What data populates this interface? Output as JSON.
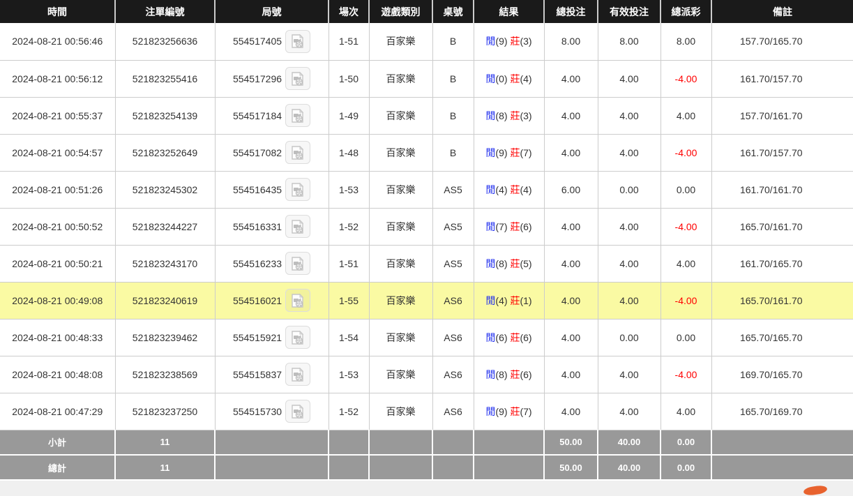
{
  "colors": {
    "header_bg": "#1a1a1a",
    "highlight_row": "#fafaa3",
    "player_blue": "#1f2dee",
    "banker_red": "#ff0000",
    "bet_amount_blue": "#2f6be4",
    "negative_red": "#ff0000",
    "summary_bg": "#999999"
  },
  "table": {
    "headers": [
      "時間",
      "注單編號",
      "局號",
      "場次",
      "遊戲類別",
      "桌號",
      "結果",
      "總投注",
      "有效投注",
      "總派彩",
      "備註"
    ],
    "rows": [
      {
        "time": "2024-08-21 00:56:46",
        "bet_id": "521823256636",
        "round": "554517405",
        "session": "1-51",
        "game": "百家樂",
        "table_no": "B",
        "result": {
          "player_label": "閒",
          "player_score": "(9)",
          "banker_label": "莊",
          "banker_score": "(3)"
        },
        "total_bet": "8.00",
        "valid_bet": "8.00",
        "payout": "8.00",
        "remark": "157.70/165.70",
        "highlight": false
      },
      {
        "time": "2024-08-21 00:56:12",
        "bet_id": "521823255416",
        "round": "554517296",
        "session": "1-50",
        "game": "百家樂",
        "table_no": "B",
        "result": {
          "player_label": "閒",
          "player_score": "(0)",
          "banker_label": "莊",
          "banker_score": "(4)"
        },
        "total_bet": "4.00",
        "valid_bet": "4.00",
        "payout": "-4.00",
        "remark": "161.70/157.70",
        "highlight": false
      },
      {
        "time": "2024-08-21 00:55:37",
        "bet_id": "521823254139",
        "round": "554517184",
        "session": "1-49",
        "game": "百家樂",
        "table_no": "B",
        "result": {
          "player_label": "閒",
          "player_score": "(8)",
          "banker_label": "莊",
          "banker_score": "(3)"
        },
        "total_bet": "4.00",
        "valid_bet": "4.00",
        "payout": "4.00",
        "remark": "157.70/161.70",
        "highlight": false
      },
      {
        "time": "2024-08-21 00:54:57",
        "bet_id": "521823252649",
        "round": "554517082",
        "session": "1-48",
        "game": "百家樂",
        "table_no": "B",
        "result": {
          "player_label": "閒",
          "player_score": "(9)",
          "banker_label": "莊",
          "banker_score": "(7)"
        },
        "total_bet": "4.00",
        "valid_bet": "4.00",
        "payout": "-4.00",
        "remark": "161.70/157.70",
        "highlight": false
      },
      {
        "time": "2024-08-21 00:51:26",
        "bet_id": "521823245302",
        "round": "554516435",
        "session": "1-53",
        "game": "百家樂",
        "table_no": "AS5",
        "result": {
          "player_label": "閒",
          "player_score": "(4)",
          "banker_label": "莊",
          "banker_score": "(4)"
        },
        "total_bet": "6.00",
        "valid_bet": "0.00",
        "payout": "0.00",
        "remark": "161.70/161.70",
        "highlight": false
      },
      {
        "time": "2024-08-21 00:50:52",
        "bet_id": "521823244227",
        "round": "554516331",
        "session": "1-52",
        "game": "百家樂",
        "table_no": "AS5",
        "result": {
          "player_label": "閒",
          "player_score": "(7)",
          "banker_label": "莊",
          "banker_score": "(6)"
        },
        "total_bet": "4.00",
        "valid_bet": "4.00",
        "payout": "-4.00",
        "remark": "165.70/161.70",
        "highlight": false
      },
      {
        "time": "2024-08-21 00:50:21",
        "bet_id": "521823243170",
        "round": "554516233",
        "session": "1-51",
        "game": "百家樂",
        "table_no": "AS5",
        "result": {
          "player_label": "閒",
          "player_score": "(8)",
          "banker_label": "莊",
          "banker_score": "(5)"
        },
        "total_bet": "4.00",
        "valid_bet": "4.00",
        "payout": "4.00",
        "remark": "161.70/165.70",
        "highlight": false
      },
      {
        "time": "2024-08-21 00:49:08",
        "bet_id": "521823240619",
        "round": "554516021",
        "session": "1-55",
        "game": "百家樂",
        "table_no": "AS6",
        "result": {
          "player_label": "閒",
          "player_score": "(4)",
          "banker_label": "莊",
          "banker_score": "(1)"
        },
        "total_bet": "4.00",
        "valid_bet": "4.00",
        "payout": "-4.00",
        "remark": "165.70/161.70",
        "highlight": true
      },
      {
        "time": "2024-08-21 00:48:33",
        "bet_id": "521823239462",
        "round": "554515921",
        "session": "1-54",
        "game": "百家樂",
        "table_no": "AS6",
        "result": {
          "player_label": "閒",
          "player_score": "(6)",
          "banker_label": "莊",
          "banker_score": "(6)"
        },
        "total_bet": "4.00",
        "valid_bet": "0.00",
        "payout": "0.00",
        "remark": "165.70/165.70",
        "highlight": false
      },
      {
        "time": "2024-08-21 00:48:08",
        "bet_id": "521823238569",
        "round": "554515837",
        "session": "1-53",
        "game": "百家樂",
        "table_no": "AS6",
        "result": {
          "player_label": "閒",
          "player_score": "(8)",
          "banker_label": "莊",
          "banker_score": "(6)"
        },
        "total_bet": "4.00",
        "valid_bet": "4.00",
        "payout": "-4.00",
        "remark": "169.70/165.70",
        "highlight": false
      },
      {
        "time": "2024-08-21 00:47:29",
        "bet_id": "521823237250",
        "round": "554515730",
        "session": "1-52",
        "game": "百家樂",
        "table_no": "AS6",
        "result": {
          "player_label": "閒",
          "player_score": "(9)",
          "banker_label": "莊",
          "banker_score": "(7)"
        },
        "total_bet": "4.00",
        "valid_bet": "4.00",
        "payout": "4.00",
        "remark": "165.70/169.70",
        "highlight": false
      }
    ],
    "summary_rows": [
      {
        "label": "小計",
        "count": "11",
        "total_bet": "50.00",
        "valid_bet": "40.00",
        "payout": "0.00"
      },
      {
        "label": "總計",
        "count": "11",
        "total_bet": "50.00",
        "valid_bet": "40.00",
        "payout": "0.00"
      }
    ],
    "video_icon_name": "video-replay-icon"
  }
}
